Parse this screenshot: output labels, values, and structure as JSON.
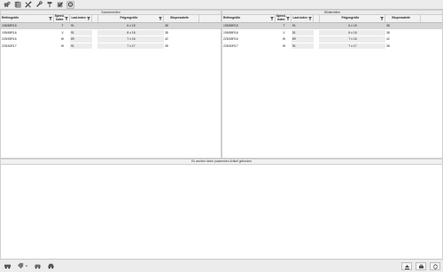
{
  "toolbar": {
    "buttons": [
      {
        "icon": "car-search-icon"
      },
      {
        "icon": "tire-catalog-icon"
      },
      {
        "icon": "tools-icon"
      },
      {
        "icon": "wrench-icon"
      },
      {
        "icon": "hammer-icon"
      },
      {
        "icon": "checklist-icon"
      },
      {
        "icon": "wheel-icon",
        "active": true
      }
    ]
  },
  "columns": {
    "size": "Reifengröße",
    "speed": "Speed-\nIndex",
    "load": "Last.index",
    "rim": "Felgengröße",
    "press": "Einpresstiefe"
  },
  "summer": {
    "title": "Sommerreifen",
    "rows": [
      {
        "size": "195/65R15",
        "speed": "T",
        "load": "91",
        "rim": "6 x 15",
        "press": "38"
      },
      {
        "size": "195/65R16",
        "speed": "V",
        "load": "91",
        "rim": "6 x 16",
        "press": "38"
      },
      {
        "size": "225/45R16",
        "speed": "W",
        "load": "89",
        "rim": "7 x 16",
        "press": "42"
      },
      {
        "size": "225/40R17",
        "speed": "W",
        "load": "91",
        "rim": "7 x 17",
        "press": "38"
      }
    ]
  },
  "winter": {
    "title": "Winterreifen",
    "rows": [
      {
        "size": "195/65R15",
        "speed": "T",
        "load": "91",
        "rim": "6 x 15",
        "press": "38"
      },
      {
        "size": "195/65R16",
        "speed": "V",
        "load": "91",
        "rim": "6 x 16",
        "press": "38"
      },
      {
        "size": "225/45R16",
        "speed": "W",
        "load": "89",
        "rim": "7 x 16",
        "press": "42"
      },
      {
        "size": "225/40R17",
        "speed": "W",
        "load": "91",
        "rim": "7 x 17",
        "press": "38"
      }
    ]
  },
  "message": "Es wurden keine passenden Artikel gefunden",
  "bottombar": {
    "left": [
      "vehicle-icon",
      "tag-dropdown-icon",
      "car-icon",
      "car-alt-icon"
    ],
    "right": [
      "eject-icon",
      "print-icon",
      "expand-icon"
    ]
  }
}
